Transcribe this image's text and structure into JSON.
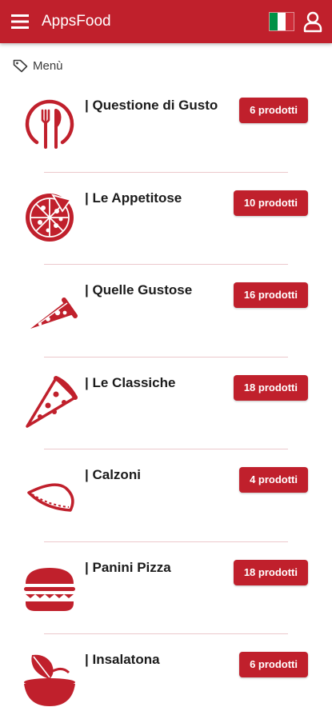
{
  "header": {
    "menu_icon": "hamburger-menu-icon",
    "title": "AppsFood",
    "flag_icon": "italy-flag-icon",
    "flag_colors": [
      "#009246",
      "#ffffff",
      "#ce2b37"
    ],
    "user_icon": "user-profile-icon"
  },
  "breadcrumb": {
    "icon": "tag-icon",
    "label": "Menù"
  },
  "colors": {
    "accent": "#c0202c",
    "divider": "#ecc8cc"
  },
  "categories": [
    {
      "name": "| Questione di Gusto",
      "count": "6 prodotti",
      "icon": "plate-cutlery-icon"
    },
    {
      "name": "| Le Appetitose",
      "count": "10 prodotti",
      "icon": "whole-pizza-icon"
    },
    {
      "name": "| Quelle Gustose",
      "count": "16 prodotti",
      "icon": "pizza-slice-icon"
    },
    {
      "name": "| Le Classiche",
      "count": "18 prodotti",
      "icon": "pizza-slice-large-icon"
    },
    {
      "name": "| Calzoni",
      "count": "4 prodotti",
      "icon": "calzone-icon"
    },
    {
      "name": "| Panini Pizza",
      "count": "18 prodotti",
      "icon": "burger-icon"
    },
    {
      "name": "| Insalatona",
      "count": "6 prodotti",
      "icon": "salad-bowl-icon"
    }
  ]
}
